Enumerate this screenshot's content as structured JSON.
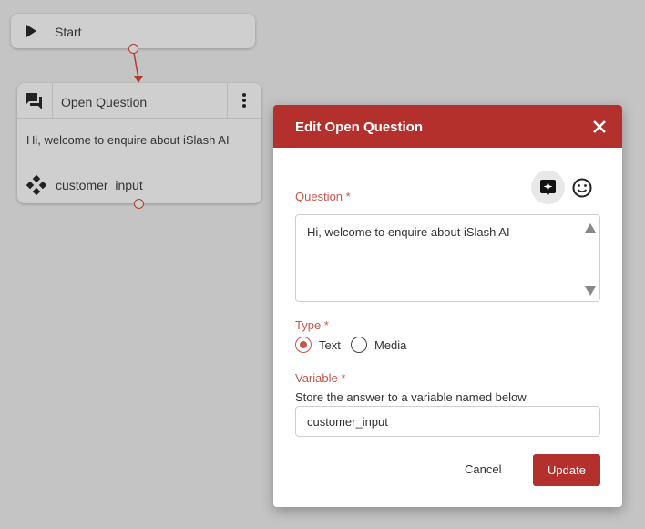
{
  "canvas": {
    "start_node": {
      "label": "Start",
      "icon": "play-icon"
    },
    "open_question_node": {
      "title": "Open Question",
      "text": "Hi, welcome to enquire about iSlash AI",
      "variable": "customer_input",
      "icons": [
        "chat-icon",
        "more-vertical-icon",
        "variable-icon"
      ]
    }
  },
  "dialog": {
    "title": "Edit Open Question",
    "question_label": "Question *",
    "question_value": "Hi, welcome to enquire about iSlash AI",
    "type_label": "Type *",
    "type_options": [
      "Text",
      "Media"
    ],
    "type_selected": "Text",
    "variable_label": "Variable *",
    "variable_help": "Store the answer to a variable named below",
    "variable_value": "customer_input",
    "cancel_label": "Cancel",
    "update_label": "Update"
  },
  "colors": {
    "accent": "#b3302c",
    "label": "#c9554b",
    "canvas": "#c4c4c4",
    "node": "#cfcfcf"
  }
}
